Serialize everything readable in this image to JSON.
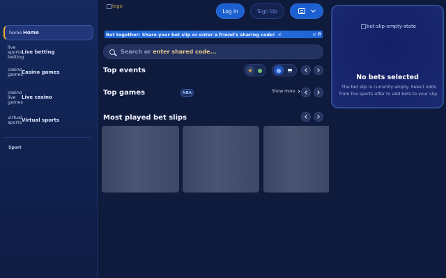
{
  "header": {
    "logo_alt": "logo",
    "login_label": "Log in",
    "signup_label": "Sign Up"
  },
  "sidebar": {
    "items": [
      {
        "icon_alt": "home",
        "label": "Home",
        "active": true
      },
      {
        "icon_alt": "live sports betting",
        "label": "Live betting"
      },
      {
        "icon_alt": "casino games",
        "label": "Casino games"
      },
      {
        "icon_alt": "casino live games",
        "label": "Live casino"
      },
      {
        "icon_alt": "virtual sports",
        "label": "Virtual sports"
      }
    ],
    "section_label": "Sport"
  },
  "banner": {
    "text": "Bet together: Share your bet slip or enter a friend's sharing code!",
    "trailing": "B"
  },
  "search": {
    "placeholder_main": "Search or",
    "placeholder_accent": "enter shared code..."
  },
  "sections": {
    "top_events": "Top events",
    "top_games": "Top games",
    "top_games_chip": "NBA",
    "show_more": "Show more",
    "most_played": "Most played bet slips"
  },
  "betslip": {
    "image_alt": "bet-slip-empty-state",
    "title": "No bets selected",
    "description": "The bet slip is currently empty. Select odds from the sports offer to add bets to your slip."
  },
  "icons": {
    "search": "search-icon",
    "ticket": "ticket-icon",
    "chevron": "chevron-down-icon",
    "share": "share-icon",
    "star": "star-icon",
    "football": "football-icon",
    "list": "list-icon"
  },
  "colors": {
    "background": "#0f1b3d",
    "accent_blue": "#1c5fd0",
    "accent_gold": "#f2b233"
  }
}
